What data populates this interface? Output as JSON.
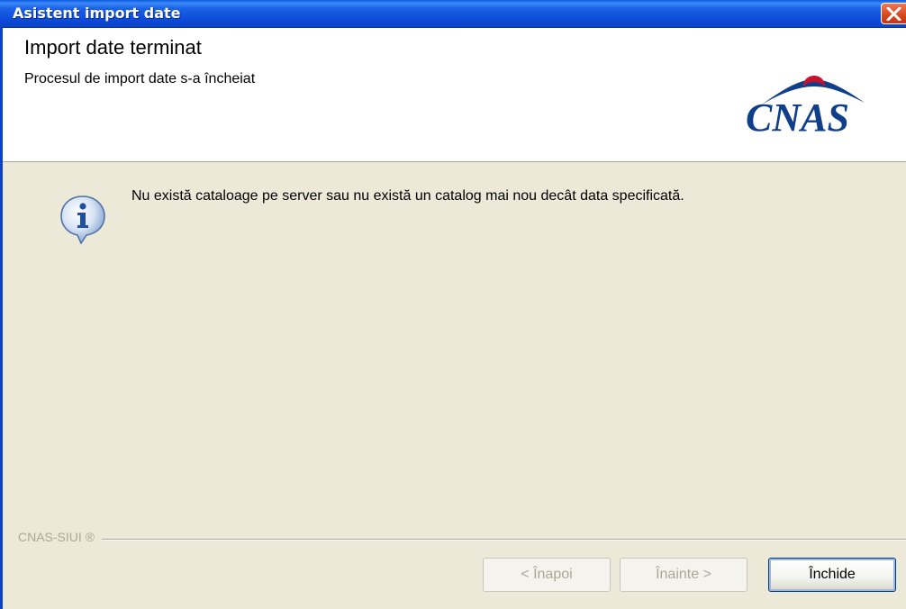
{
  "window": {
    "title": "Asistent import date",
    "close_icon": "close-icon"
  },
  "header": {
    "title": "Import date terminat",
    "subtitle": "Procesul de import date s-a încheiat",
    "logo_text": "CNAS"
  },
  "message": {
    "icon": "info-icon",
    "text": "Nu există cataloage pe server sau nu există un catalog mai nou decât data specificată."
  },
  "footer": {
    "brand": "CNAS-SIUI ®"
  },
  "buttons": {
    "back": "< Înapoi",
    "next": "Înainte >",
    "close": "Închide"
  },
  "colors": {
    "titlebar": "#0B43C8",
    "dialog_bg": "#ECE9D8",
    "logo": "#0F3E8A",
    "close_button": "#D4471F"
  }
}
